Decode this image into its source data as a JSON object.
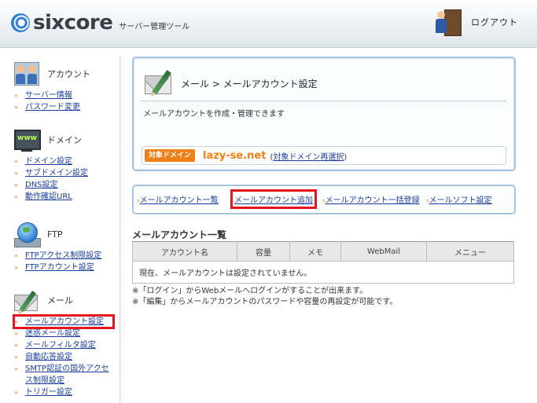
{
  "header": {
    "brand": "sixcore",
    "tagline": "サーバー管理ツール",
    "logout_label": "ログアウト"
  },
  "sidebar": {
    "sections": [
      {
        "title": "アカウント",
        "items": [
          "サーバー情報",
          "パスワード変更"
        ]
      },
      {
        "title": "ドメイン",
        "items": [
          "ドメイン設定",
          "サブドメイン設定",
          "DNS設定",
          "動作確認URL"
        ]
      },
      {
        "title": "FTP",
        "items": [
          "FTPアクセス制限設定",
          "FTPアカウント設定"
        ]
      },
      {
        "title": "メール",
        "items": [
          "メールアカウント設定",
          "迷惑メール設定",
          "メールフィルタ設定",
          "自動応答設定",
          "SMTP認証の国外アクセス制限設定",
          "トリガー設定"
        ]
      }
    ]
  },
  "panel": {
    "title": "メール > メールアカウント設定",
    "description": "メールアカウントを作成・管理できます",
    "domain_badge": "対象ドメイン",
    "domain_name": "lazy-se.net",
    "domain_change_open": "(",
    "domain_change_link": "対象ドメイン再選択",
    "domain_change_close": ")"
  },
  "tabs": [
    {
      "label": "メールアカウント一覧",
      "active": false
    },
    {
      "label": "メールアカウント追加",
      "active": true
    },
    {
      "label": "メールアカウント一括登録",
      "active": false
    },
    {
      "label": "メールソフト設定",
      "active": false
    }
  ],
  "list": {
    "title": "メールアカウント一覧",
    "columns": [
      "アカウント名",
      "容量",
      "メモ",
      "WebMail",
      "メニュー"
    ],
    "empty_message": "現在、メールアカウントは設定されていません。"
  },
  "notes": [
    "※「ログイン」からWebメールへログインがすることが出来ます。",
    "※「編集」からメールアカウントのパスワードや容量の再設定が可能です。"
  ],
  "colors": {
    "accent_orange": "#ef7f16",
    "link_blue": "#1a3f9e",
    "highlight_red": "#e8141b",
    "panel_border": "#a6c3df"
  }
}
